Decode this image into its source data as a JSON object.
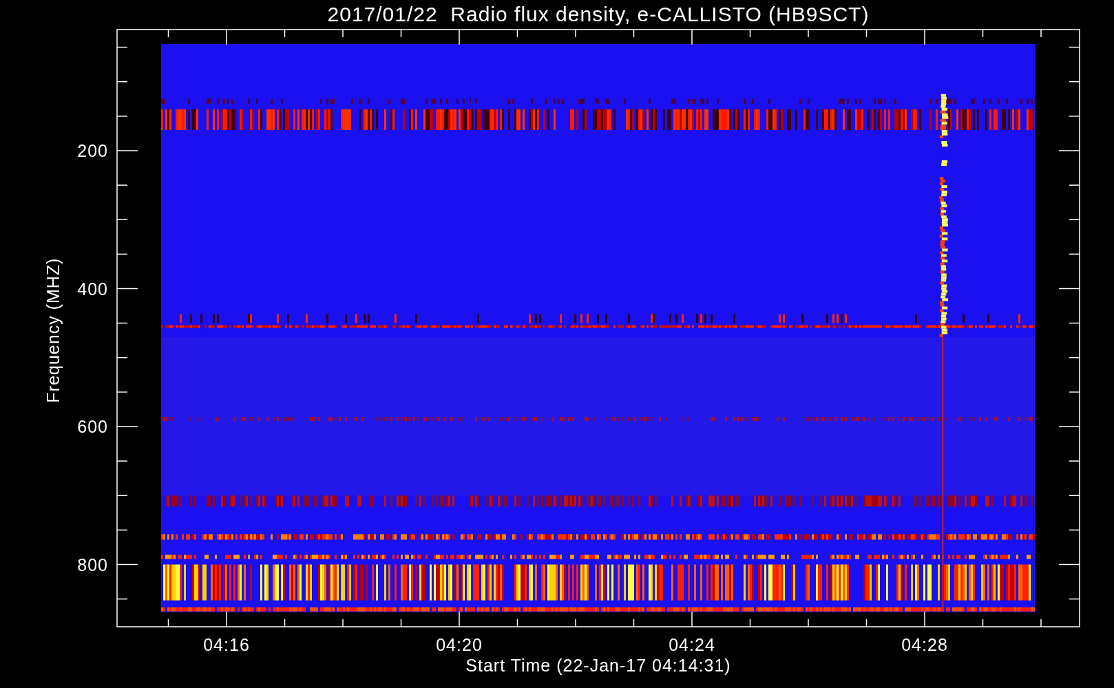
{
  "plot": {
    "title": "2017/01/22  Radio flux density, e-CALLISTO (HB9SCT)",
    "xlabel": "Start Time (22-Jan-17 04:14:31)",
    "ylabel": "Frequency (MHZ)",
    "xtick_labels": [
      "04:16",
      "04:20",
      "04:24",
      "04:28"
    ],
    "ytick_labels": [
      "200",
      "400",
      "600",
      "800"
    ]
  }
}
